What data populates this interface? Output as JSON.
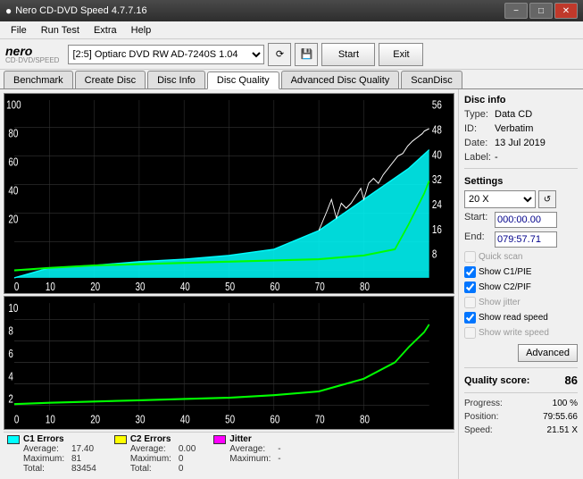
{
  "titlebar": {
    "title": "Nero CD-DVD Speed 4.7.7.16",
    "icon": "nero-icon",
    "minimize": "−",
    "maximize": "□",
    "close": "✕"
  },
  "menubar": {
    "items": [
      "File",
      "Run Test",
      "Extra",
      "Help"
    ]
  },
  "toolbar": {
    "drive_label": "[2:5]",
    "drive_value": "Optiarc DVD RW AD-7240S 1.04",
    "start_label": "Start",
    "exit_label": "Exit"
  },
  "tabs": [
    {
      "label": "Benchmark",
      "active": false
    },
    {
      "label": "Create Disc",
      "active": false
    },
    {
      "label": "Disc Info",
      "active": false
    },
    {
      "label": "Disc Quality",
      "active": true
    },
    {
      "label": "Advanced Disc Quality",
      "active": false
    },
    {
      "label": "ScanDisc",
      "active": false
    }
  ],
  "disc_info": {
    "section": "Disc info",
    "type_label": "Type:",
    "type_value": "Data CD",
    "id_label": "ID:",
    "id_value": "Verbatim",
    "date_label": "Date:",
    "date_value": "13 Jul 2019",
    "label_label": "Label:",
    "label_value": "-"
  },
  "settings": {
    "section": "Settings",
    "speed_value": "20 X",
    "start_label": "Start:",
    "start_value": "000:00.00",
    "end_label": "End:",
    "end_value": "079:57.71",
    "quick_scan": "Quick scan",
    "show_c1pie": "Show C1/PIE",
    "show_c2pif": "Show C2/PIF",
    "show_jitter": "Show jitter",
    "show_read_speed": "Show read speed",
    "show_write_speed": "Show write speed",
    "advanced_btn": "Advanced"
  },
  "quality": {
    "score_label": "Quality score:",
    "score_value": "86",
    "progress_label": "Progress:",
    "progress_value": "100 %",
    "position_label": "Position:",
    "position_value": "79:55.66",
    "speed_label": "Speed:",
    "speed_value": "21.51 X"
  },
  "legend": {
    "c1_label": "C1 Errors",
    "c1_color": "#00ffff",
    "c1_avg_label": "Average:",
    "c1_avg_value": "17.40",
    "c1_max_label": "Maximum:",
    "c1_max_value": "81",
    "c1_total_label": "Total:",
    "c1_total_value": "83454",
    "c2_label": "C2 Errors",
    "c2_color": "#ffff00",
    "c2_avg_label": "Average:",
    "c2_avg_value": "0.00",
    "c2_max_label": "Maximum:",
    "c2_max_value": "0",
    "c2_total_label": "Total:",
    "c2_total_value": "0",
    "jitter_label": "Jitter",
    "jitter_color": "#ff00ff",
    "jitter_avg_label": "Average:",
    "jitter_avg_value": "-",
    "jitter_max_label": "Maximum:",
    "jitter_max_value": "-"
  },
  "chart1": {
    "y_labels_right": [
      "56",
      "48",
      "40",
      "32",
      "24",
      "16",
      "8"
    ],
    "y_labels_left": [
      "100",
      "80",
      "60",
      "40",
      "20"
    ],
    "x_labels": [
      "0",
      "10",
      "20",
      "30",
      "40",
      "50",
      "60",
      "70",
      "80"
    ]
  },
  "chart2": {
    "y_labels": [
      "10",
      "8",
      "6",
      "4",
      "2"
    ],
    "x_labels": [
      "0",
      "10",
      "20",
      "30",
      "40",
      "50",
      "60",
      "70",
      "80"
    ]
  }
}
